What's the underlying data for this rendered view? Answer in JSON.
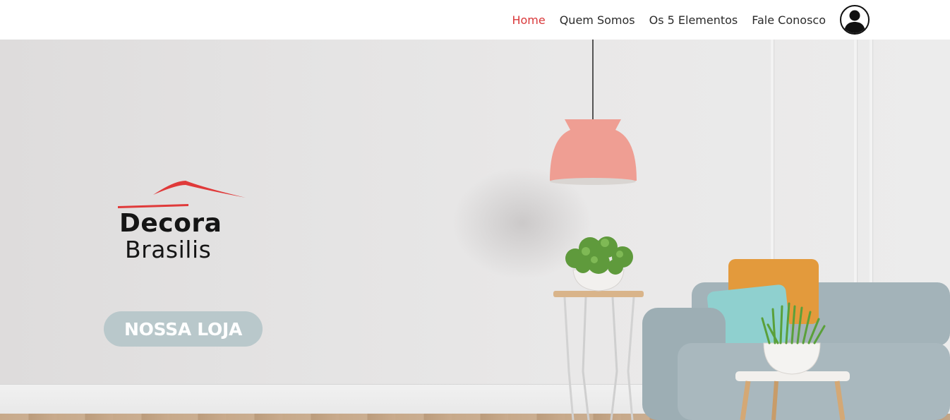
{
  "nav": {
    "items": [
      {
        "label": "Home",
        "active": true
      },
      {
        "label": "Quem Somos",
        "active": false
      },
      {
        "label": "Os 5 Elementos",
        "active": false
      },
      {
        "label": "Fale Conosco",
        "active": false
      }
    ],
    "user_icon": "user-avatar-icon"
  },
  "hero": {
    "logo": {
      "line1": "Decora",
      "line2": "Brasilis",
      "icon": "roof-icon"
    },
    "cta_label": "NOSSA LOJA"
  },
  "colors": {
    "nav_active": "#d9383a",
    "nav_text": "#2b2b2b",
    "cta_bg": "#b9c8cb",
    "logo_roof": "#e03a3a"
  }
}
